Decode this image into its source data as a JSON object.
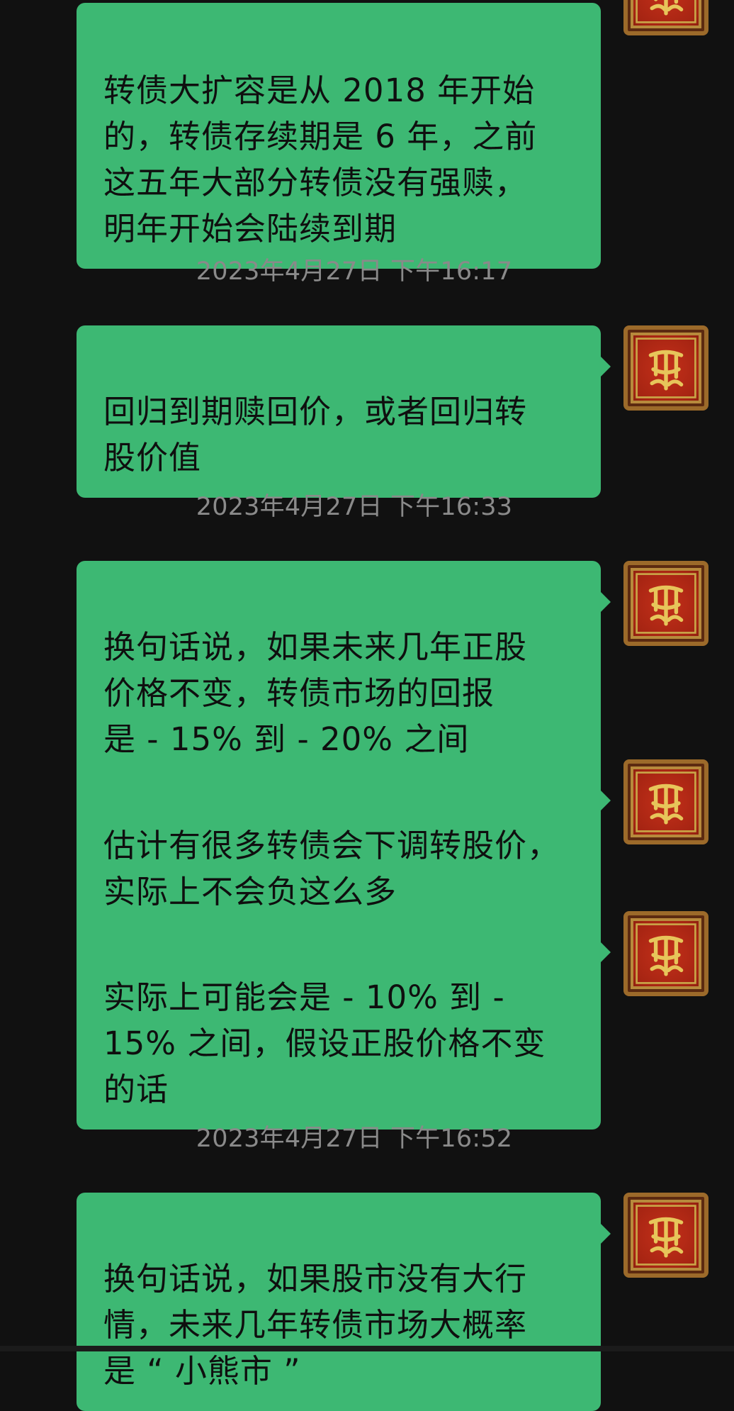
{
  "colors": {
    "background": "#111111",
    "bubble_green": "#3db873",
    "timestamp_gray": "#8a8a8a",
    "avatar_red": "#c4301a",
    "avatar_gold": "#c9a447"
  },
  "messages": [
    {
      "type": "bubble",
      "text": "转债大扩容是从 2018 年开始\n的，转债存续期是 6 年，之前\n这五年大部分转债没有强赎，\n明年开始会陆续到期"
    },
    {
      "type": "timestamp",
      "text": "2023年4月27日 下午16:17"
    },
    {
      "type": "bubble",
      "text": "回归到期赎回价，或者回归转\n股价值"
    },
    {
      "type": "timestamp",
      "text": "2023年4月27日 下午16:33"
    },
    {
      "type": "bubble",
      "text": "换句话说，如果未来几年正股\n价格不变，转债市场的回报\n是 - 15% 到 - 20% 之间"
    },
    {
      "type": "bubble",
      "text": "估计有很多转债会下调转股价，\n实际上不会负这么多"
    },
    {
      "type": "bubble",
      "text": "实际上可能会是 - 10% 到 -\n15% 之间，假设正股价格不变\n的话"
    },
    {
      "type": "timestamp",
      "text": "2023年4月27日 下午16:52"
    },
    {
      "type": "bubble",
      "text": "换句话说，如果股市没有大行\n情，未来几年转债市场大概率\n是 “ 小熊市 ”"
    }
  ],
  "avatar_icon": "red-gold-seal-avatar-icon"
}
